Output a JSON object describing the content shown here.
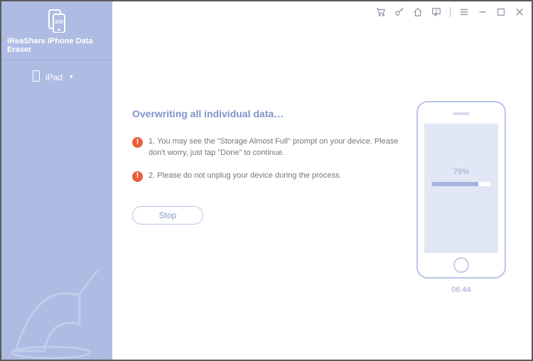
{
  "brand": {
    "product_name": "iReaShare iPhone Data Eraser"
  },
  "sidebar": {
    "device_label": "iPad"
  },
  "main": {
    "heading": "Overwriting all individual data…",
    "warnings": [
      "1. You may see the \"Storage Almost Full\" prompt on your device. Please don't worry, just tap \"Done\" to continue.",
      "2. Please do not unplug your device during the process."
    ],
    "stop_label": "Stop"
  },
  "progress": {
    "percent_label": "79%",
    "percent_value": 79,
    "elapsed": "06:44"
  }
}
